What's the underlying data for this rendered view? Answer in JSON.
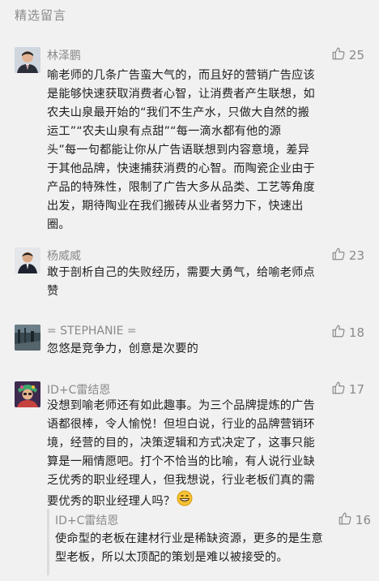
{
  "section": {
    "title": "精选留言"
  },
  "comments": [
    {
      "name": "林泽鹏",
      "likes": "25",
      "lines": [
        "喻老师的几条广告蛮大气的，而且好的营销广告应该",
        "是能够快速获取消费者心智，让消费者产生联想，如",
        "农夫山泉最开始的“我们不生产水，只做大自然的搬",
        "运工”“农夫山泉有点甜”“每一滴水都有他的源",
        "头”每一句都能让你从广告语联想到内容意境，差异",
        "于其他品牌，快速捕获消费的心智。而陶瓷企业由于",
        "产品的特殊性，限制了广告大多从品类、工艺等角度",
        "出发，期待陶业在我们搬砖从业者努力下，快速出",
        "圈。"
      ]
    },
    {
      "name": "杨威威",
      "likes": "23",
      "lines": [
        "敢于剖析自己的失败经历，需要大勇气，给喻老师点",
        "赞"
      ]
    },
    {
      "name": "= STEPHANIE =",
      "likes": "18",
      "lines": [
        "忽悠是竞争力，创意是次要的"
      ]
    },
    {
      "name": "ID+C雷结恩",
      "likes": "17",
      "lines": [
        "没想到喻老师还有如此趣事。为三个品牌提炼的广告",
        "语都很棒，令人愉悦！但坦白说，行业的品牌营销环",
        "境，经营的目的，决策逻辑和方式决定了，这事只能",
        "算是一厢情愿吧。打个不恰当的比喻，有人说行业缺",
        "乏优秀的职业经理人，但我想说，行业老板们真的需",
        "要优秀的职业经理人吗？"
      ],
      "emoji": "grin-emoji"
    }
  ],
  "reply": {
    "name": "ID+C雷结恩",
    "likes": "16",
    "lines": [
      "使命型的老板在建材行业是稀缺资源，更多的是生意",
      "型老板，所以太顶配的策划是难以被接受的。"
    ]
  },
  "colors": {
    "background": "#f1f1f1",
    "meta_text": "#8a8a8a",
    "body_text": "#1f1f1f"
  }
}
